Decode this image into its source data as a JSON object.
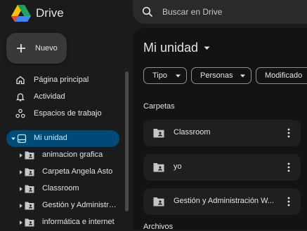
{
  "app": {
    "name": "Drive"
  },
  "search": {
    "placeholder": "Buscar en Drive"
  },
  "new_button": {
    "label": "Nuevo"
  },
  "nav": [
    {
      "label": "Página principal",
      "icon": "home-icon"
    },
    {
      "label": "Actividad",
      "icon": "bell-icon"
    },
    {
      "label": "Espacios de trabajo",
      "icon": "workspaces-icon"
    }
  ],
  "my_drive": {
    "label": "Mi unidad",
    "icon": "drive-icon"
  },
  "tree": [
    {
      "label": "animacion grafica"
    },
    {
      "label": "Carpeta Angela Asto"
    },
    {
      "label": "Classroom"
    },
    {
      "label": "Gestión y Administra..."
    },
    {
      "label": "informática e internet"
    }
  ],
  "main": {
    "title": "Mi unidad",
    "filters": [
      {
        "label": "Tipo"
      },
      {
        "label": "Personas"
      },
      {
        "label": "Modificado"
      }
    ],
    "folders_heading": "Carpetas",
    "folders": [
      {
        "name": "Classroom"
      },
      {
        "name": "yo"
      },
      {
        "name": "Gestión y Administración W..."
      }
    ],
    "files_heading": "Archivos"
  },
  "colors": {
    "accent_selected": "#004a77",
    "accent_text": "#c2e7ff",
    "background": "#1b1b1b",
    "surface": "#131314"
  }
}
